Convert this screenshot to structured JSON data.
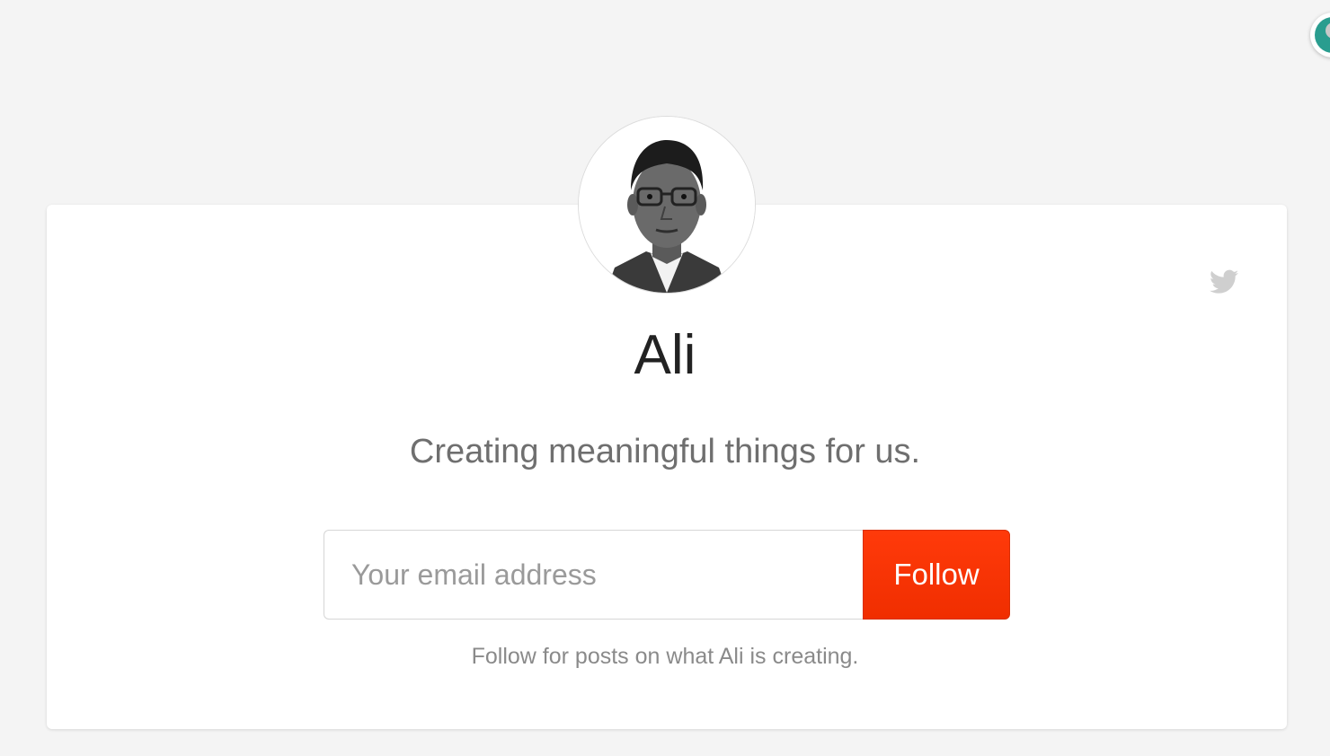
{
  "profile": {
    "name": "Ali",
    "tagline": "Creating meaningful things for us."
  },
  "subscribe": {
    "email_placeholder": "Your email address",
    "email_value": "",
    "follow_label": "Follow",
    "helper_text": "Follow for posts on what Ali is creating."
  },
  "icons": {
    "social": "twitter-icon",
    "corner": "user-avatar-icon"
  },
  "colors": {
    "background": "#f4f4f4",
    "card": "#ffffff",
    "accent": "#f53200",
    "name_text": "#222222",
    "muted_text": "#6f6f6f"
  }
}
